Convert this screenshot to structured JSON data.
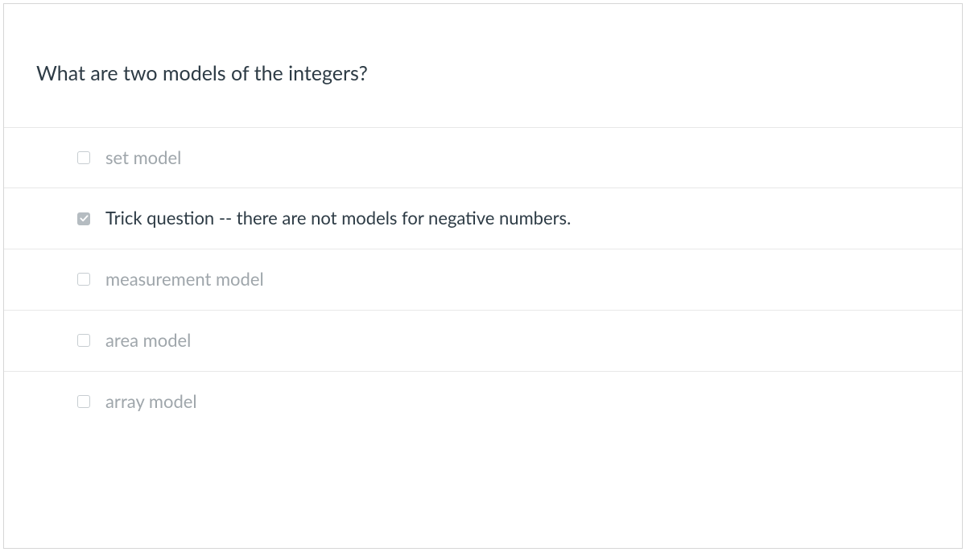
{
  "question": {
    "text": "What are two models of the integers?"
  },
  "options": [
    {
      "label": "set model",
      "checked": false
    },
    {
      "label": "Trick question -- there are not models for negative numbers.",
      "checked": true
    },
    {
      "label": "measurement model",
      "checked": false
    },
    {
      "label": "area model",
      "checked": false
    },
    {
      "label": "array model",
      "checked": false
    }
  ]
}
